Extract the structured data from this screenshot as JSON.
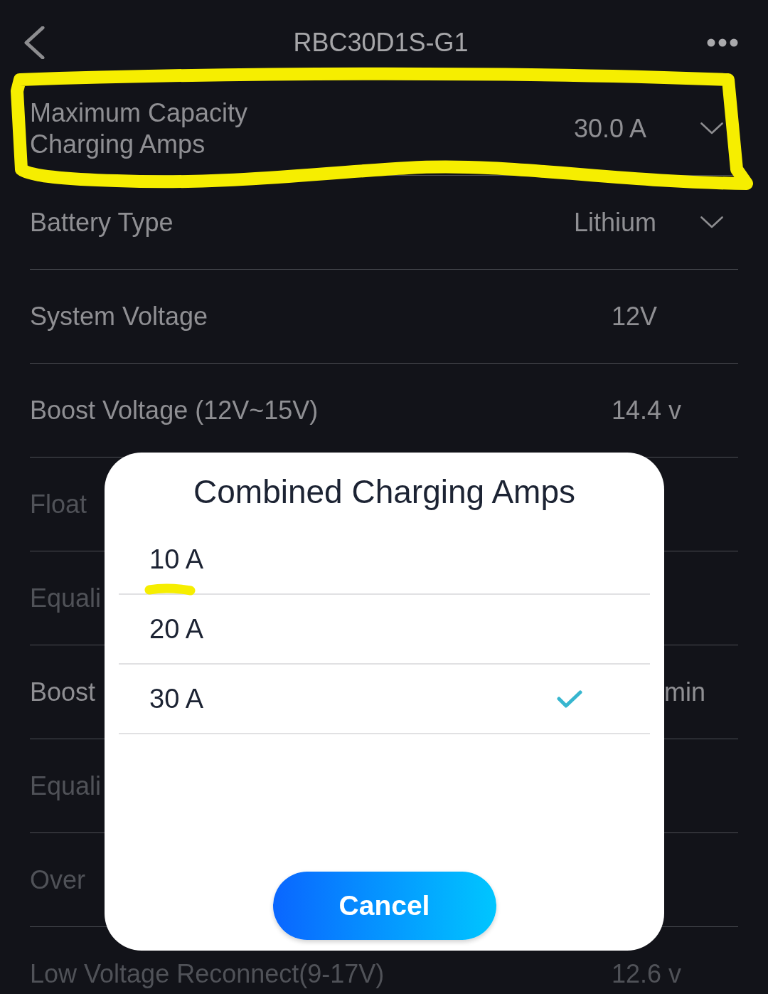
{
  "header": {
    "title": "RBC30D1S-G1"
  },
  "settings": [
    {
      "label": "Maximum Capacity\nCharging Amps",
      "value": "30.0 A",
      "kind": "dropdown",
      "disabled": false,
      "marked": true
    },
    {
      "label": "Battery Type",
      "value": "Lithium",
      "kind": "dropdown",
      "disabled": false,
      "marked": false
    },
    {
      "label": "System Voltage",
      "value": "12V",
      "kind": "reading",
      "disabled": false,
      "marked": false
    },
    {
      "label": "Boost Voltage (12V~15V)",
      "value": "14.4 v",
      "kind": "reading",
      "disabled": false,
      "marked": false
    },
    {
      "label": "Float",
      "kind": "reading",
      "disabled": true,
      "marked": false
    },
    {
      "label": "Equali",
      "kind": "reading",
      "disabled": true,
      "marked": false
    },
    {
      "label": "Boost",
      "value": "min",
      "kind": "partial",
      "disabled": false,
      "marked": false
    },
    {
      "label": "Equali",
      "kind": "reading",
      "disabled": true,
      "marked": false
    },
    {
      "label": "Over",
      "kind": "reading",
      "disabled": true,
      "marked": false
    },
    {
      "label": "Low Voltage Reconnect(9-17V)",
      "value": "12.6 v",
      "kind": "reading",
      "disabled": true,
      "marked": false
    }
  ],
  "dialog": {
    "title": "Combined Charging Amps",
    "options": [
      {
        "label": "10 A",
        "selected": false,
        "marked": true
      },
      {
        "label": "20 A",
        "selected": false,
        "marked": false
      },
      {
        "label": "30 A",
        "selected": true,
        "marked": false
      }
    ],
    "cancel_button": "Cancel"
  }
}
